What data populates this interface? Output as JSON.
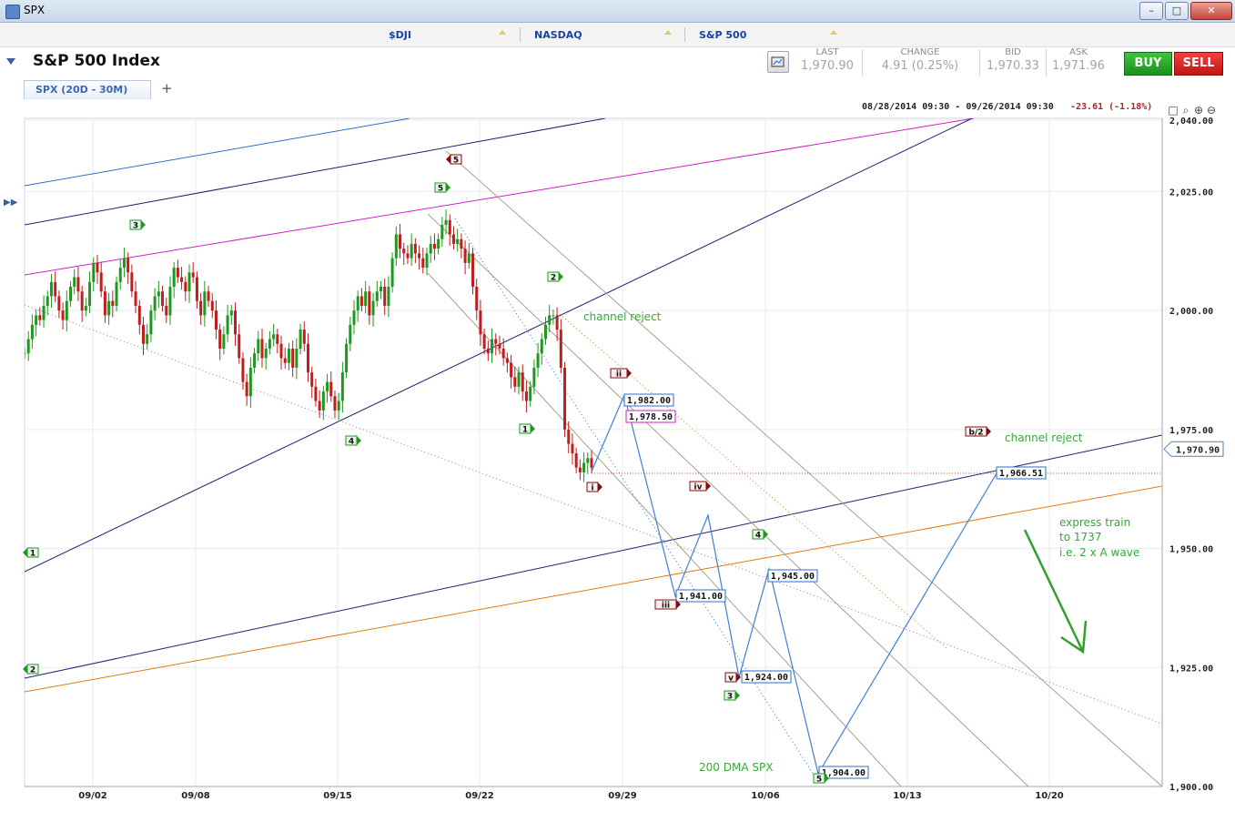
{
  "window": {
    "title": "SPX"
  },
  "indices": [
    "$DJI",
    "NASDAQ",
    "S&P 500"
  ],
  "header": {
    "title": "S&P 500 Index"
  },
  "quote": [
    {
      "label": "LAST",
      "value": "1,970.90"
    },
    {
      "label": "CHANGE",
      "value": "4.91 (0.25%)"
    },
    {
      "label": "BID",
      "value": "1,970.33"
    },
    {
      "label": "ASK",
      "value": "1,971.96"
    }
  ],
  "buttons": {
    "buy": "BUY",
    "sell": "SELL"
  },
  "tab": {
    "label": "SPX (20D - 30M)",
    "add": "+"
  },
  "range": {
    "text": "08/28/2014 09:30 - 09/26/2014 09:30",
    "change": "-23.61 (-1.18%)"
  },
  "colors": {
    "up": "#1d9a1d",
    "down": "#c21d1d",
    "accent": "#3d7fd6",
    "green_text": "#35a935"
  },
  "chart_data": {
    "type": "candlestick",
    "ylim": [
      1900,
      2040
    ],
    "y_ticks": [
      "2,040.00",
      "2,025.00",
      "2,000.00",
      "1,975.00",
      "1,950.00",
      "1,925.00",
      "1,900.00"
    ],
    "x_ticks": [
      "09/02",
      "09/08",
      "09/15",
      "09/22",
      "09/29",
      "10/06",
      "10/13",
      "10/20"
    ],
    "last_price_label": "1,970.90",
    "price_path": [
      1991,
      1994,
      1997,
      1999,
      1998,
      2001,
      2003,
      2006,
      2003,
      2000,
      1998,
      2002,
      2005,
      2007,
      2004,
      2000,
      2001,
      2006,
      2010,
      2008,
      2004,
      1999,
      2002,
      2001,
      2006,
      2009,
      2011,
      2008,
      2004,
      2001,
      1997,
      1993,
      1995,
      2000,
      2003,
      2004,
      2001,
      1999,
      2005,
      2009,
      2007,
      2006,
      2004,
      2008,
      2007,
      2002,
      1999,
      2004,
      2002,
      2000,
      1996,
      1992,
      1995,
      1999,
      2000,
      1995,
      1990,
      1985,
      1982,
      1988,
      1991,
      1994,
      1990,
      1992,
      1994,
      1995,
      1993,
      1990,
      1989,
      1992,
      1988,
      1992,
      1996,
      1993,
      1987,
      1984,
      1981,
      1979,
      1983,
      1985,
      1982,
      1979,
      1981,
      1987,
      1993,
      1997,
      2000,
      2003,
      2001,
      2004,
      1999,
      2002,
      2004,
      2005,
      2001,
      2005,
      2011,
      2016,
      2013,
      2012,
      2011,
      2014,
      2012,
      2011,
      2009,
      2012,
      2014,
      2013,
      2015,
      2018,
      2019,
      2016,
      2014,
      2015,
      2013,
      2010,
      2012,
      2005,
      2000,
      1995,
      1992,
      1991,
      1994,
      1993,
      1992,
      1990,
      1989,
      1986,
      1984,
      1987,
      1983,
      1981,
      1984,
      1988,
      1991,
      1994,
      1997,
      1999,
      1999,
      1996,
      1988,
      1975,
      1972,
      1970,
      1967,
      1966,
      1968,
      1969,
      1967
    ],
    "projection_labels": [
      "1,982.00",
      "1,978.50",
      "1,941.00",
      "1,945.00",
      "1,924.00",
      "1,904.00",
      "1,966.51"
    ],
    "wave_labels": [
      "3",
      "5",
      "5",
      "2",
      "1",
      "4",
      "1",
      "2",
      "i",
      "ii",
      "iii",
      "iv",
      "v",
      "4",
      "3",
      "5",
      "b/2"
    ],
    "annotations": [
      "channel reject",
      "channel reject",
      "express train",
      "to 1737",
      "i.e. 2 x A wave",
      "200 DMA SPX"
    ]
  }
}
